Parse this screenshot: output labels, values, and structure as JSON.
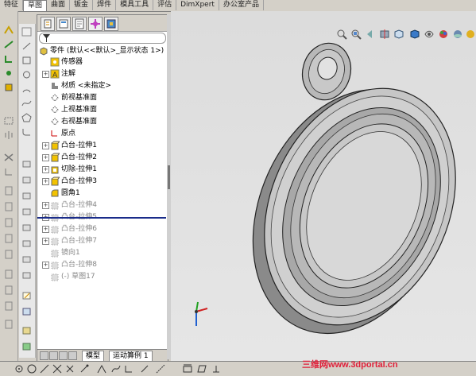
{
  "command_tabs": [
    "特征",
    "草图",
    "曲面",
    "钣金",
    "焊件",
    "模具工具",
    "评估",
    "DimXpert",
    "办公室产品"
  ],
  "active_tab": "草图",
  "tree": {
    "root": "零件 (默认<<默认>_显示状态 1>)",
    "items": [
      {
        "label": "传感器",
        "expander": false,
        "gray": false,
        "icon": "sensor-icon"
      },
      {
        "label": "注解",
        "expander": true,
        "gray": false,
        "icon": "annotation-icon"
      },
      {
        "label": "材质 <未指定>",
        "expander": false,
        "gray": false,
        "icon": "material-icon"
      },
      {
        "label": "前视基准面",
        "expander": false,
        "gray": false,
        "icon": "plane-icon"
      },
      {
        "label": "上视基准面",
        "expander": false,
        "gray": false,
        "icon": "plane-icon"
      },
      {
        "label": "右视基准面",
        "expander": false,
        "gray": false,
        "icon": "plane-icon"
      },
      {
        "label": "原点",
        "expander": false,
        "gray": false,
        "icon": "origin-icon"
      },
      {
        "label": "凸台-拉伸1",
        "expander": true,
        "gray": false,
        "icon": "extrude-icon"
      },
      {
        "label": "凸台-拉伸2",
        "expander": true,
        "gray": false,
        "icon": "extrude-icon"
      },
      {
        "label": "切除-拉伸1",
        "expander": true,
        "gray": false,
        "icon": "cut-icon"
      },
      {
        "label": "凸台-拉伸3",
        "expander": true,
        "gray": false,
        "icon": "extrude-icon"
      },
      {
        "label": "圆角1",
        "expander": false,
        "gray": false,
        "icon": "fillet-icon"
      },
      {
        "label": "凸台-拉伸4",
        "expander": true,
        "gray": true,
        "icon": "extrude-icon"
      },
      {
        "label": "凸台-拉伸5",
        "expander": true,
        "gray": true,
        "icon": "extrude-icon"
      },
      {
        "label": "凸台-拉伸6",
        "expander": true,
        "gray": true,
        "icon": "extrude-icon"
      },
      {
        "label": "凸台-拉伸7",
        "expander": true,
        "gray": true,
        "icon": "extrude-icon"
      },
      {
        "label": "镜向1",
        "expander": false,
        "gray": true,
        "icon": "mirror-icon"
      },
      {
        "label": "凸台-拉伸8",
        "expander": true,
        "gray": true,
        "icon": "extrude-icon"
      },
      {
        "label": "(-) 草图17",
        "expander": false,
        "gray": true,
        "icon": "sketch-icon"
      }
    ]
  },
  "bottom_tabs": [
    "模型",
    "运动算例 1"
  ],
  "watermark": "三维网www.3dportal.cn",
  "colors": {
    "rollback_bar": "#1a2c8a",
    "watermark": "#e0203a",
    "tree_icon_yellow": "#f2c200"
  }
}
